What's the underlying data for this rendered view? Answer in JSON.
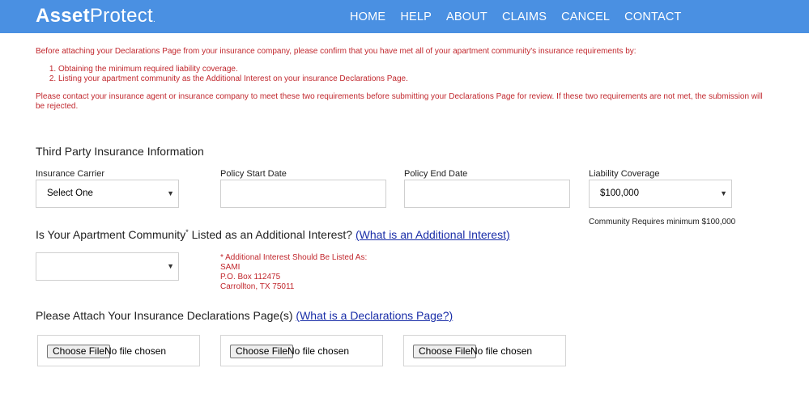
{
  "header": {
    "logo_bold": "Asset",
    "logo_light": "Protect",
    "logo_dot": ".",
    "nav": [
      "HOME",
      "HELP",
      "ABOUT",
      "CLAIMS",
      "CANCEL",
      "CONTACT"
    ]
  },
  "notice": {
    "intro": "Before attaching your Declarations Page from your insurance company, please confirm that you have met all of your apartment community's insurance requirements by:",
    "requirements": [
      "Obtaining the minimum required liability coverage.",
      "Listing your apartment community as the Additional Interest on your insurance Declarations Page."
    ],
    "warning": "Please contact your insurance agent or insurance company to meet these two requirements before submitting your Declarations Page for review. If these two requirements are not met, the submission will be rejected."
  },
  "third_party": {
    "title": "Third Party Insurance Information",
    "carrier_label": "Insurance Carrier",
    "carrier_value": "Select One",
    "start_label": "Policy Start Date",
    "start_value": "",
    "end_label": "Policy End Date",
    "end_value": "",
    "liability_label": "Liability Coverage",
    "liability_value": "$100,000",
    "minimum_note": "Community Requires minimum $100,000"
  },
  "additional_interest": {
    "question": "Is Your Apartment Community",
    "asterisk": "*",
    "question_rest": " Listed as an Additional Interest?",
    "link": "(What is an Additional Interest)",
    "select_value": "",
    "address": [
      "* Additional Interest Should Be Listed As:",
      "SAMI",
      "P.O. Box 112475",
      "Carrollton, TX 75011"
    ]
  },
  "attach": {
    "title": "Please Attach Your Insurance Declarations Page(s)",
    "link": "(What is a Declarations Page?)",
    "files": [
      {
        "button": "Choose File",
        "status": "No file chosen"
      },
      {
        "button": "Choose File",
        "status": "No file chosen"
      },
      {
        "button": "Choose File",
        "status": "No file chosen"
      }
    ]
  },
  "icons": {
    "select_chevron": "chevron-down-icon"
  },
  "colors": {
    "header_bg": "#4a90e2",
    "notice_text": "#c1272d",
    "link": "#1a2ea8"
  }
}
